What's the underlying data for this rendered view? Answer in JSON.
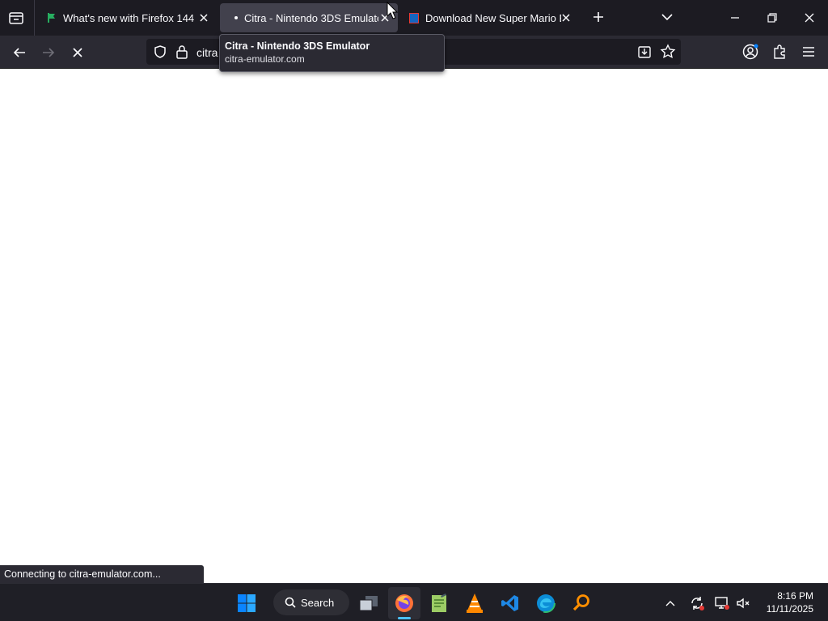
{
  "browser": {
    "tabs": [
      {
        "title": "What's new with Firefox 144",
        "active": false
      },
      {
        "title": "Citra - Nintendo 3DS Emulator",
        "active": true,
        "loading": true
      },
      {
        "title": "Download New Super Mario Bros",
        "active": false
      }
    ],
    "url_text": "citra",
    "tooltip": {
      "title": "Citra - Nintendo 3DS Emulator",
      "domain": "citra-emulator.com"
    },
    "status_text": "Connecting to citra-emulator.com..."
  },
  "taskbar": {
    "search_label": "Search",
    "clock": {
      "time": "8:16 PM",
      "date": "11/11/2025"
    },
    "apps": [
      "start-icon",
      "search-icon",
      "task-view-icon",
      "firefox-icon",
      "notepad-icon",
      "vlc-icon",
      "vscode-icon",
      "edge-icon",
      "search-everything-icon"
    ]
  },
  "colors": {
    "active_tab": "#42414d",
    "toolbar": "#2b2a33",
    "tabstrip": "#1c1b22",
    "accent": "#0078d4"
  }
}
